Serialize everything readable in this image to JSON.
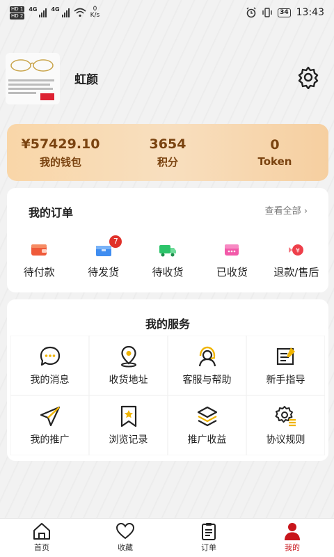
{
  "status_bar": {
    "sim1": "HD 1",
    "sim2": "HD 2",
    "net1": "4G",
    "net2": "4G",
    "speed_value": "0",
    "speed_unit": "K/s",
    "battery": "34",
    "time": "13:43"
  },
  "profile": {
    "nickname": "虹颜"
  },
  "wallet": {
    "balance_value": "¥57429.10",
    "balance_label": "我的钱包",
    "points_value": "3654",
    "points_label": "积分",
    "token_value": "0",
    "token_label": "Token"
  },
  "orders": {
    "title": "我的订单",
    "view_all": "查看全部 ›",
    "items": [
      {
        "label": "待付款",
        "icon": "wallet-icon"
      },
      {
        "label": "待发货",
        "icon": "box-icon",
        "badge": "7"
      },
      {
        "label": "待收货",
        "icon": "truck-icon"
      },
      {
        "label": "已收货",
        "icon": "received-icon"
      },
      {
        "label": "退款/售后",
        "icon": "refund-icon"
      }
    ]
  },
  "services": {
    "title": "我的服务",
    "items": [
      {
        "label": "我的消息",
        "icon": "message-icon"
      },
      {
        "label": "收货地址",
        "icon": "location-icon"
      },
      {
        "label": "客服与帮助",
        "icon": "customer-service-icon"
      },
      {
        "label": "新手指导",
        "icon": "guide-icon"
      },
      {
        "label": "我的推广",
        "icon": "paper-plane-icon"
      },
      {
        "label": "浏览记录",
        "icon": "bookmark-icon"
      },
      {
        "label": "推广收益",
        "icon": "layers-icon"
      },
      {
        "label": "协议规则",
        "icon": "gear-doc-icon"
      }
    ]
  },
  "tabbar": {
    "items": [
      {
        "label": "首页",
        "icon": "home-icon"
      },
      {
        "label": "收藏",
        "icon": "heart-icon"
      },
      {
        "label": "订单",
        "icon": "clipboard-icon"
      },
      {
        "label": "我的",
        "icon": "user-icon"
      }
    ],
    "active_color": "#c8151b"
  },
  "colors": {
    "wallet_text": "#7a4310",
    "accent_yellow": "#f0b400",
    "badge_red": "#e0312a"
  }
}
